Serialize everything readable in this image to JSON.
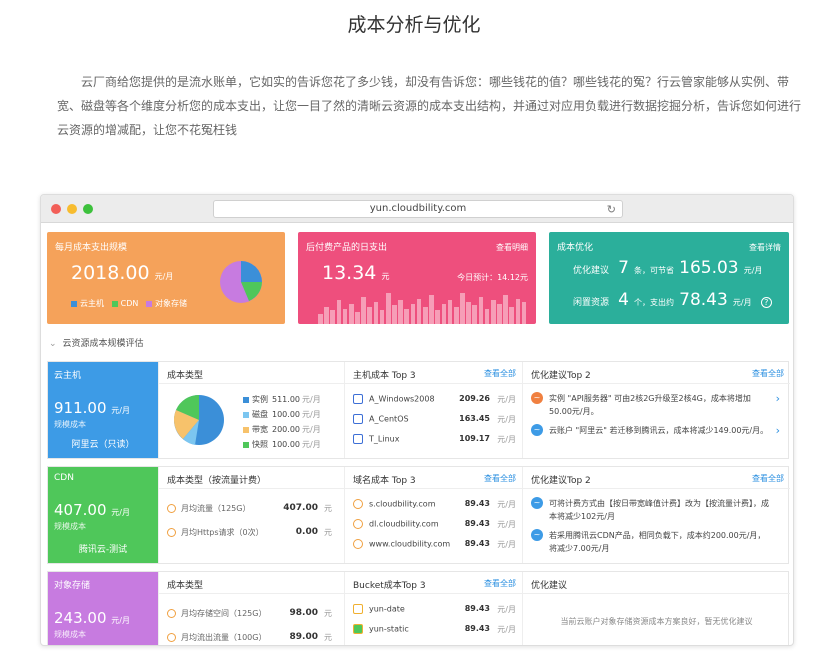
{
  "page": {
    "title": "成本分析与优化",
    "intro": "云厂商给您提供的是流水账单，它如实的告诉您花了多少钱，却没有告诉您：哪些钱花的值？哪些钱花的冤？行云管家能够从实例、带宽、磁盘等各个维度分析您的成本支出，让您一目了然的清晰云资源的成本支出结构，并通过对应用负载进行数据挖掘分析，告诉您如何进行云资源的增减配，让您不花冤枉钱"
  },
  "browser": {
    "url": "yun.cloudbility.com",
    "reload_icon": "↻"
  },
  "colors": {
    "orange": "#f5a25a",
    "pink": "#ee4f7d",
    "teal": "#2baf9b",
    "blue": "#3d9be6",
    "green": "#4fc75a",
    "purple": "#c77be0",
    "link": "#2a8fe0"
  },
  "kpi": {
    "monthly": {
      "title": "每月成本支出规模",
      "amount": "2018.00",
      "unit": "元/月",
      "legend": [
        "云主机",
        "CDN",
        "对象存储"
      ],
      "pie_colors": [
        "#3b8fd8",
        "#4fc75a",
        "#c77be0"
      ]
    },
    "daily": {
      "title": "后付费产品的日支出",
      "link": "查看明细",
      "amount": "13.34",
      "unit": "元",
      "forecast": "今日预计：14.12元",
      "bars": [
        0.3,
        0.5,
        0.4,
        0.7,
        0.45,
        0.6,
        0.35,
        0.8,
        0.5,
        0.65,
        0.4,
        0.9,
        0.55,
        0.7,
        0.45,
        0.6,
        0.75,
        0.5,
        0.85,
        0.4,
        0.6,
        0.7,
        0.5,
        0.9,
        0.65,
        0.55,
        0.8,
        0.45,
        0.7,
        0.6,
        0.85,
        0.5,
        0.75,
        0.65
      ]
    },
    "optimize": {
      "title": "成本优化",
      "link": "查看详情",
      "row1_label": "优化建议",
      "row1_count": "7",
      "row1_mid": "条，可节省",
      "row1_amount": "165.03",
      "row1_unit": "元/月",
      "row2_label": "闲置资源",
      "row2_count": "4",
      "row2_mid": "个，支出约",
      "row2_amount": "78.43",
      "row2_unit": "元/月",
      "help_icon": "?"
    }
  },
  "section_title": "云资源成本规模评估",
  "collapse_icon": "⌄",
  "ecs": {
    "name": "云主机",
    "amount": "911.00",
    "unit": "元/月",
    "sub": "规模成本",
    "region": "阿里云（只读）",
    "type_title": "成本类型",
    "types": [
      {
        "label": "实例",
        "value": "511.00",
        "unit": "元/月",
        "color": "#3b8fd8"
      },
      {
        "label": "磁盘",
        "value": "100.00",
        "unit": "元/月",
        "color": "#7cc6f0"
      },
      {
        "label": "带宽",
        "value": "200.00",
        "unit": "元/月",
        "color": "#f7c26b"
      },
      {
        "label": "快照",
        "value": "100.00",
        "unit": "元/月",
        "color": "#4fc75a"
      }
    ],
    "top_title": "主机成本 Top 3",
    "top_link": "查看全部",
    "top": [
      {
        "name": "A_Windows2008",
        "value": "209.26",
        "unit": "元/月"
      },
      {
        "name": "A_CentOS",
        "value": "163.45",
        "unit": "元/月"
      },
      {
        "name": "T_Linux",
        "value": "109.17",
        "unit": "元/月"
      }
    ],
    "sug_title": "优化建议Top 2",
    "sug_link": "查看全部",
    "sug": [
      {
        "text": "实例 \"API服务器\" 可由2核2G升级至2核4G，成本将增加50.00元/月。",
        "color": "#f08040"
      },
      {
        "text": "云账户 \"阿里云\" 若迁移到腾讯云，成本将减少149.00元/月。",
        "color": "#3d9be6"
      }
    ]
  },
  "cdn": {
    "name": "CDN",
    "amount": "407.00",
    "unit": "元/月",
    "sub": "规模成本",
    "region": "腾讯云-测试",
    "type_title": "成本类型（按流量计费）",
    "types": [
      {
        "label": "月均流量（125G）",
        "value": "407.00",
        "unit": "元"
      },
      {
        "label": "月均Https请求（0次）",
        "value": "0.00",
        "unit": "元"
      }
    ],
    "top_title": "域名成本 Top 3",
    "top_link": "查看全部",
    "top": [
      {
        "name": "s.cloudbility.com",
        "value": "89.43",
        "unit": "元/月"
      },
      {
        "name": "dl.cloudbility.com",
        "value": "89.43",
        "unit": "元/月"
      },
      {
        "name": "www.cloudbility.com",
        "value": "89.43",
        "unit": "元/月"
      }
    ],
    "sug_title": "优化建议Top 2",
    "sug_link": "查看全部",
    "sug": [
      {
        "text": "可将计费方式由【按日带宽峰值计费】改为【按流量计费】，成本将减少102元/月",
        "color": "#3d9be6"
      },
      {
        "text": "若采用腾讯云CDN产品，相同负载下，成本约200.00元/月，将减少7.00元/月",
        "color": "#3d9be6"
      }
    ]
  },
  "oss": {
    "name": "对象存储",
    "amount": "243.00",
    "unit": "元/月",
    "sub": "规模成本",
    "type_title": "成本类型",
    "types": [
      {
        "label": "月均存储空间（125G）",
        "value": "98.00",
        "unit": "元"
      },
      {
        "label": "月均流出流量（100G）",
        "value": "89.00",
        "unit": "元"
      }
    ],
    "top_title": "Bucket成本Top 3",
    "top_link": "查看全部",
    "top": [
      {
        "name": "yun-date",
        "value": "89.43",
        "unit": "元/月"
      },
      {
        "name": "yun-static",
        "value": "89.43",
        "unit": "元/月"
      }
    ],
    "sug_title": "优化建议",
    "empty": "当前云账户对象存储资源成本方案良好，暂无优化建议"
  }
}
